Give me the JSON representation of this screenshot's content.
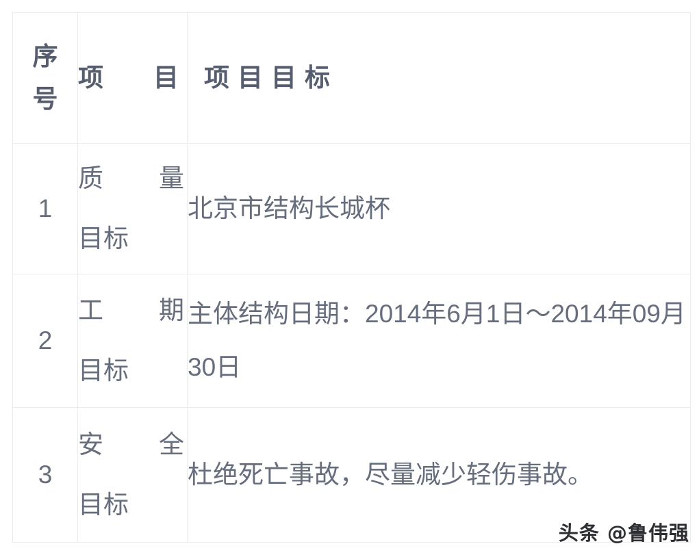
{
  "table": {
    "columns": [
      {
        "key": "index",
        "label": "序号"
      },
      {
        "key": "item",
        "label": "项目"
      },
      {
        "key": "goal",
        "label": "项目目标"
      }
    ],
    "rows": [
      {
        "index": "1",
        "item_line1": "质量",
        "item_line2": "目标",
        "item_full": "质量目标",
        "goal": "北京市结构长城杯"
      },
      {
        "index": "2",
        "item_line1": "工期",
        "item_line2": "目标",
        "item_full": "工期目标",
        "goal": "主体结构日期：2014年6月1日～2014年09月30日"
      },
      {
        "index": "3",
        "item_line1": "安全",
        "item_line2": "目标",
        "item_full": "安全目标",
        "goal": "杜绝死亡事故，尽量减少轻伤事故。"
      }
    ]
  },
  "watermark": {
    "text": "头条 @鲁伟强"
  },
  "colors": {
    "header_text": "#555d6e",
    "body_text": "#666d7d",
    "border": "#ececee",
    "background": "#ffffff",
    "watermark_text": "#2d2f33"
  }
}
